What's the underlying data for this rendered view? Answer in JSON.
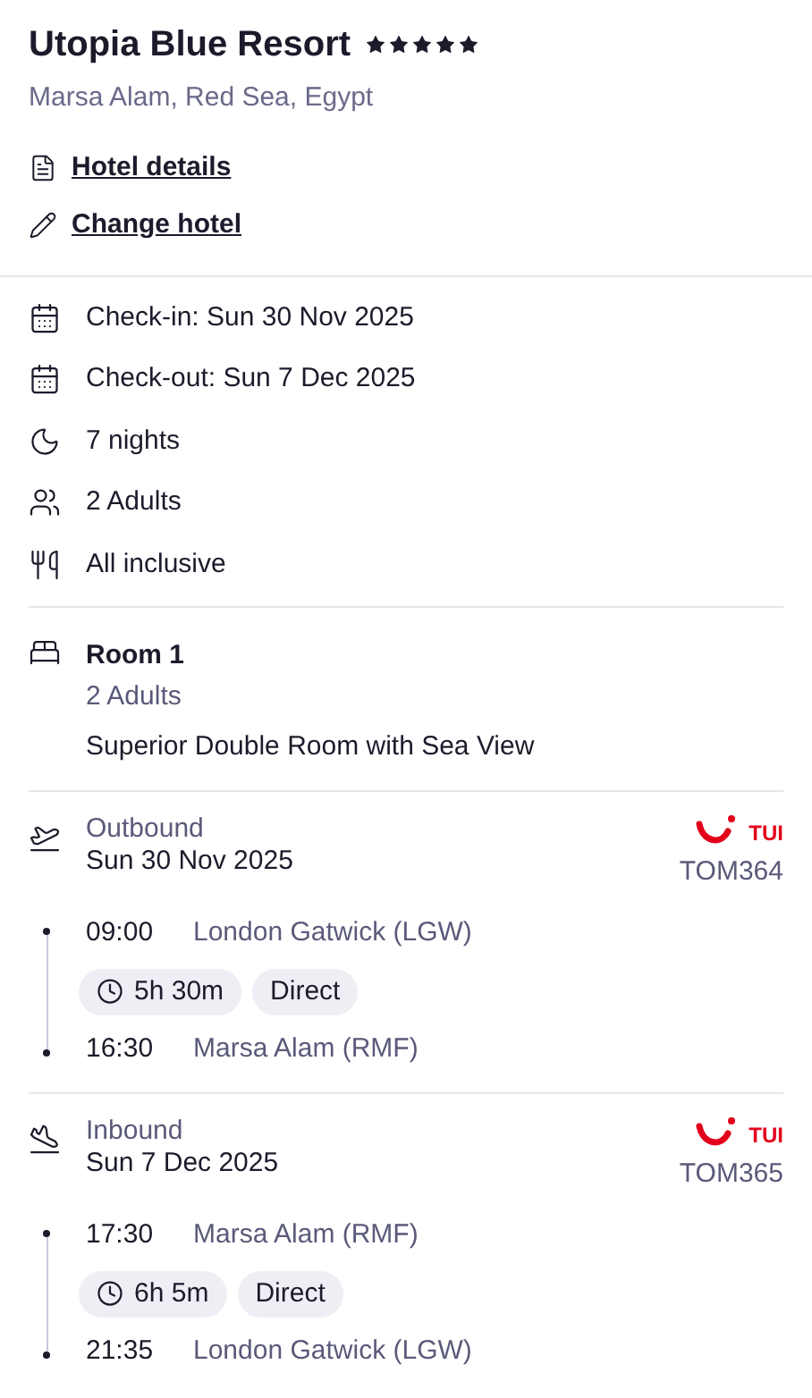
{
  "hotel": {
    "name": "Utopia Blue Resort",
    "stars": 5,
    "location": "Marsa Alam, Red Sea, Egypt"
  },
  "links": [
    {
      "kind": "details",
      "label": "Hotel details"
    },
    {
      "kind": "change",
      "label": "Change hotel"
    }
  ],
  "summary": [
    {
      "kind": "checkin",
      "text": "Check-in: Sun 30 Nov 2025"
    },
    {
      "kind": "checkout",
      "text": "Check-out: Sun 7 Dec 2025"
    },
    {
      "kind": "nights",
      "text": "7 nights"
    },
    {
      "kind": "guests",
      "text": "2 Adults"
    },
    {
      "kind": "board",
      "text": "All inclusive"
    }
  ],
  "room": {
    "title": "Room 1",
    "guests": "2 Adults",
    "type": "Superior Double Room with Sea View"
  },
  "flights": [
    {
      "kind": "outbound",
      "label": "Outbound",
      "date": "Sun 30 Nov 2025",
      "airline": "TUI",
      "flight_number": "TOM364",
      "depart_time": "09:00",
      "depart_airport": "London Gatwick (LGW)",
      "duration": "5h 30m",
      "stops": "Direct",
      "arrive_time": "16:30",
      "arrive_airport": "Marsa Alam (RMF)"
    },
    {
      "kind": "inbound",
      "label": "Inbound",
      "date": "Sun 7 Dec 2025",
      "airline": "TUI",
      "flight_number": "TOM365",
      "depart_time": "17:30",
      "depart_airport": "Marsa Alam (RMF)",
      "duration": "6h 5m",
      "stops": "Direct",
      "arrive_time": "21:35",
      "arrive_airport": "London Gatwick (LGW)"
    }
  ]
}
